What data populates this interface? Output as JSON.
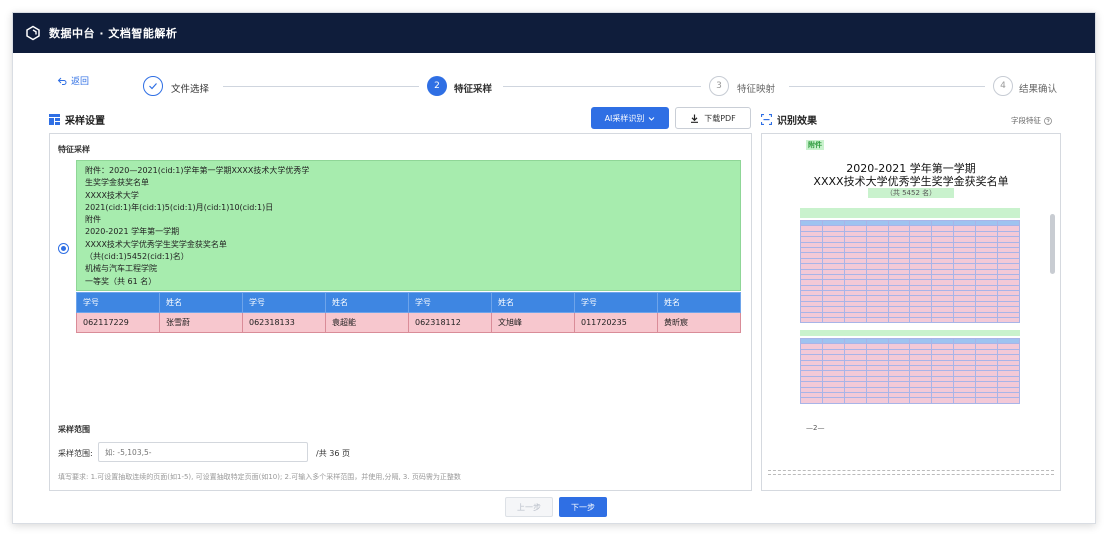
{
  "app": {
    "title": "数据中台 · 文档智能解析"
  },
  "nav": {
    "back_label": "返回"
  },
  "steps": [
    {
      "num": "1",
      "label": "文件选择",
      "state": "done"
    },
    {
      "num": "2",
      "label": "特征采样",
      "state": "active"
    },
    {
      "num": "3",
      "label": "特征映射",
      "state": "todo"
    },
    {
      "num": "4",
      "label": "结果确认",
      "state": "todo"
    }
  ],
  "sampling": {
    "title": "采样设置",
    "ai_button": "AI采样识别",
    "download_button": "下载PDF",
    "feature_label": "特征采样",
    "text_lines": [
      "附件：2020—2021(cid:1)学年第一学期XXXX技术大学优秀学",
      "生奖学金获奖名单",
      "XXXX技术大学",
      "2021(cid:1)年(cid:1)5(cid:1)月(cid:1)10(cid:1)日",
      "附件",
      "2020-2021 学年第一学期",
      "XXXX技术大学优秀学生奖学金获奖名单",
      "（共(cid:1)5452(cid:1)名）",
      "机械与汽车工程学院",
      "一等奖（共 61 名）"
    ],
    "table_headers": [
      "学号",
      "姓名",
      "学号",
      "姓名",
      "学号",
      "姓名",
      "学号",
      "姓名"
    ],
    "table_row": [
      "062117229",
      "张雪蔚",
      "062318133",
      "袁超能",
      "062318112",
      "文旭峰",
      "011720235",
      "黄昕宸"
    ],
    "range_title": "采样范围",
    "range_label": "采样范围:",
    "range_placeholder": "如: -5,103,5-",
    "range_total": "/共  36  页",
    "hint": "填写要求: 1.可设置抽取连续的页面(如1-5), 可设置抽取特定页面(如10); 2.可输入多个采样范围，并使用,分隔, 3. 页码需为正整数"
  },
  "result": {
    "title": "识别效果",
    "field_link": "字段特征",
    "doc_attach": "附件",
    "doc_title1": "2020-2021 学年第一学期",
    "doc_title2": "XXXX技术大学优秀学生奖学金获奖名单",
    "doc_count": "（共 5452 名）",
    "doc_page_no": "—2—"
  },
  "footer": {
    "prev": "上一步",
    "next": "下一步"
  },
  "colors": {
    "accent": "#2f6fe4",
    "topbar": "#0f1d3b",
    "green": "#a7ecae",
    "blue_header": "#3e86e2",
    "pink": "#f7c7ce"
  }
}
